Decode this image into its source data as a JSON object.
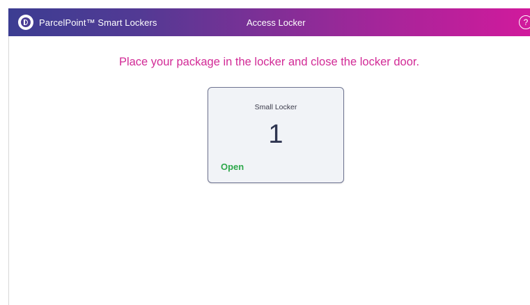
{
  "header": {
    "brand": "ParcelPoint™ Smart Lockers",
    "title": "Access Locker",
    "help_glyph": "?",
    "logo_icon": "parcelpoint-logo-icon",
    "help_icon": "help-icon"
  },
  "main": {
    "instruction": "Place your package in the locker and close the locker door.",
    "locker": {
      "size_label": "Small Locker",
      "number": "1",
      "status": "Open"
    }
  },
  "colors": {
    "header_gradient_start": "#3c3d92",
    "header_gradient_end": "#d11a9c",
    "instruction": "#d22a96",
    "status_open": "#2ea84b",
    "locker_number": "#2e3450"
  }
}
